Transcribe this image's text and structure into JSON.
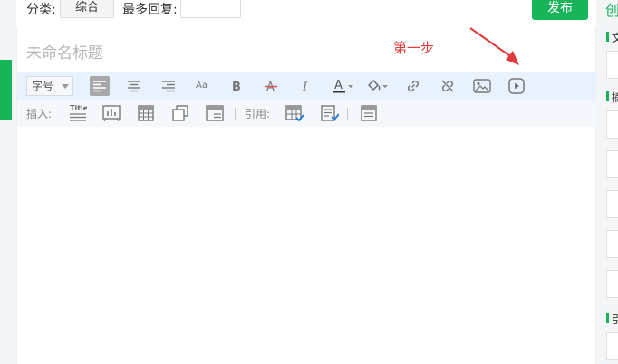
{
  "topbar": {
    "category_label": "分类:",
    "category_value": "综合",
    "max_reply_label": "最多回复:",
    "max_reply_value": "",
    "publish_label": "发布"
  },
  "editor": {
    "title_placeholder": "未命名标题",
    "annotation": "第一步",
    "toolbar": {
      "font_size_label": "字号",
      "insert_label": "插入:",
      "quote_label": "引用:"
    }
  },
  "right_panel": {
    "create_text": "创",
    "section_1_char": "文",
    "section_2_char": "摘",
    "section_3_char": "引"
  },
  "colors": {
    "brand_green": "#19b45a",
    "annotation_red": "#e03a3a",
    "toolbar_bg": "#e9f1fd"
  },
  "icons": [
    "align-left-icon",
    "align-center-icon",
    "align-right-icon",
    "font-case-icon",
    "bold-icon",
    "strikethrough-icon",
    "italic-icon",
    "font-color-icon",
    "fill-color-icon",
    "link-icon",
    "unlink-icon",
    "image-icon",
    "video-icon",
    "title-icon",
    "chart-icon",
    "table-icon",
    "layers-icon",
    "card-icon",
    "quote-table-icon",
    "quote-doc-icon",
    "quote-form-icon"
  ]
}
